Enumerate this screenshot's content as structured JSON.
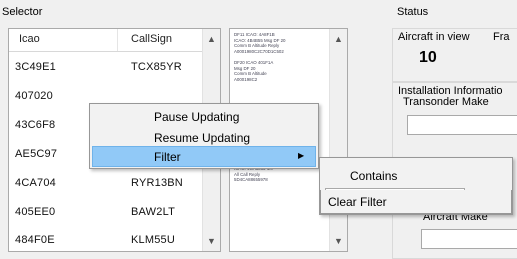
{
  "selector_label": "Selector",
  "list": {
    "columns": [
      "Icao",
      "CallSign"
    ],
    "rows": [
      {
        "icao": "3C49E1",
        "callsign": "TCX85YR"
      },
      {
        "icao": "407020",
        "callsign": ""
      },
      {
        "icao": "43C6F8",
        "callsign": ""
      },
      {
        "icao": "AE5C97",
        "callsign": ""
      },
      {
        "icao": "4CA704",
        "callsign": "RYR13BN"
      },
      {
        "icao": "405EE0",
        "callsign": "BAW2LT"
      },
      {
        "icao": "484F0E",
        "callsign": "KLM55U"
      }
    ]
  },
  "raw_panel": {
    "lines": [
      "DF11 ICAO: 4A8F1B",
      "ICAO: 4B4B55 Msg DF 20",
      "Comm B Altitude Reply",
      "A0001980C2C70D1C502",
      "",
      "DF20 ICAO 401F1A",
      "Msg DF 20",
      "Comm B Altitude",
      "A000198C2",
      "",
      "",
      "",
      "",
      "",
      "",
      "",
      "",
      "",
      "",
      "",
      "ICAO: 4CA704 Msg DF 20",
      "Comm B Altitude R",
      "A0001950FF5828",
      "C9877",
      "ICAO: 4CA8865 Ms",
      "All Call Reply",
      "5D4CA88655978",
      "",
      "",
      "",
      "",
      "",
      "",
      "",
      "",
      "",
      "",
      ""
    ]
  },
  "status": {
    "label": "Status",
    "aircraft_in_view_label": "Aircraft in view",
    "frames_label": "Fra",
    "aircraft_in_view_value": "10"
  },
  "installation": {
    "label": "Installation Informatio",
    "transponder_make_label": "Transonder Make",
    "aircraft_make_label": "Aircraft Make"
  },
  "context_menu": {
    "items": [
      "Pause Updating",
      "Resume Updating",
      "Filter"
    ],
    "submenu_arrow": "▶"
  },
  "filter_submenu": {
    "contains_label": "Contains",
    "contains_value": "",
    "clear_label": "Clear Filter"
  }
}
